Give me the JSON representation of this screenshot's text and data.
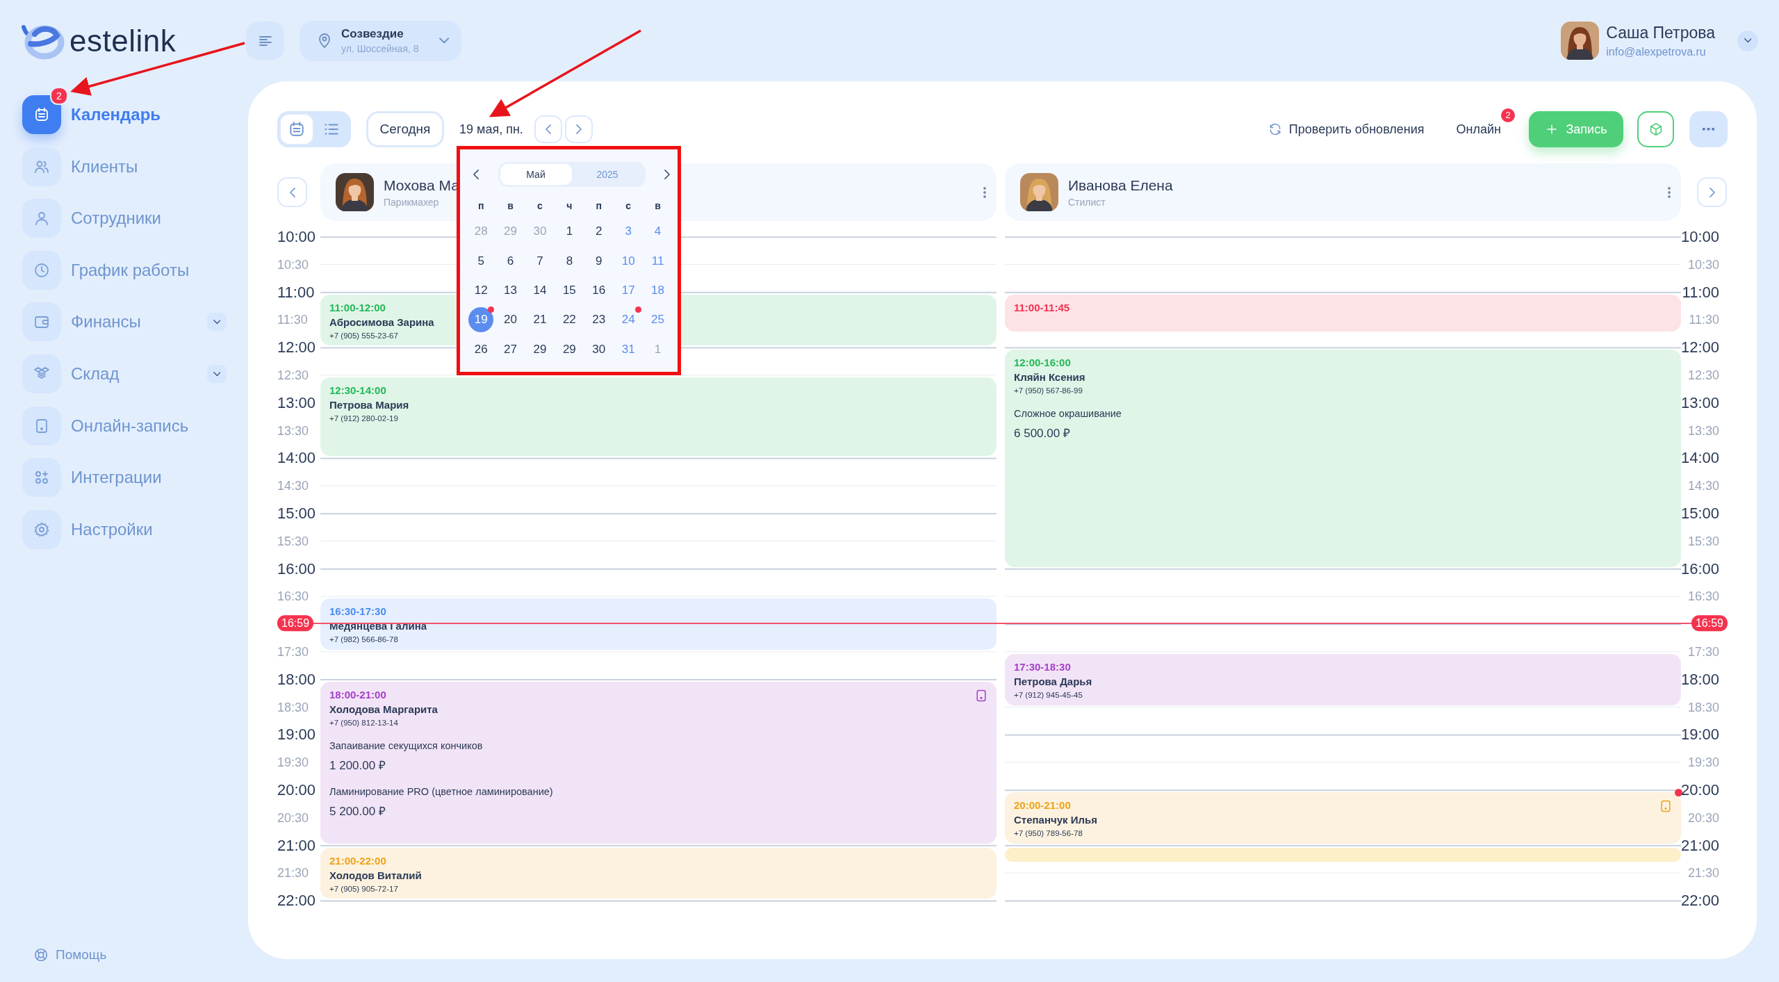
{
  "brand": {
    "name": "estelink"
  },
  "header": {
    "location": {
      "name": "Созвездие",
      "address": "ул. Шоссейная, 8"
    },
    "user": {
      "name": "Саша Петрова",
      "email": "info@alexpetrova.ru"
    }
  },
  "sidebar": {
    "items": [
      {
        "label": "Календарь",
        "selected": true,
        "badge": "2",
        "expandable": false
      },
      {
        "label": "Клиенты",
        "selected": false,
        "expandable": false
      },
      {
        "label": "Сотрудники",
        "selected": false,
        "expandable": false
      },
      {
        "label": "График работы",
        "selected": false,
        "expandable": false
      },
      {
        "label": "Финансы",
        "selected": false,
        "expandable": true
      },
      {
        "label": "Склад",
        "selected": false,
        "expandable": true
      },
      {
        "label": "Онлайн-запись",
        "selected": false,
        "expandable": false
      },
      {
        "label": "Интеграции",
        "selected": false,
        "expandable": false
      },
      {
        "label": "Настройки",
        "selected": false,
        "expandable": false
      }
    ],
    "help": "Помощь"
  },
  "toolbar": {
    "views": [
      {
        "kind": "calendar",
        "selected": true
      },
      {
        "kind": "list",
        "selected": false
      }
    ],
    "today": "Сегодня",
    "date": "19 мая, пн.",
    "check_updates": "Проверить обновления",
    "online": {
      "label": "Онлайн",
      "badge": "2"
    },
    "new_booking": "Запись"
  },
  "staff": [
    {
      "name": "Мохова Ма",
      "role": "Парикмахер"
    },
    {
      "name": "Иванова Елена",
      "role": "Стилист"
    }
  ],
  "timeline": {
    "left_labels": [
      "10:00",
      "10:30",
      "11:00",
      "11:30",
      "12:00",
      "12:30",
      "13:00",
      "13:30",
      "14:00",
      "14:30",
      "15:00",
      "15:30",
      "16:00",
      "16:30",
      "17:30",
      "18:00",
      "18:30",
      "19:00",
      "19:30",
      "20:00",
      "20:30",
      "21:00",
      "21:30",
      "22:00"
    ],
    "right_labels": [
      "10:00",
      "10:30",
      "11:00",
      "11:30",
      "12:00",
      "12:30",
      "13:00",
      "13:30",
      "14:00",
      "14:30",
      "15:00",
      "15:30",
      "16:00",
      "16:30",
      "17:30",
      "18:00",
      "18:30",
      "19:00",
      "19:30",
      "20:00",
      "20:30",
      "21:00",
      "21:30",
      "22:00"
    ],
    "now_left": "16:59",
    "now_right": "16:59",
    "columns": [
      {
        "events": [
          {
            "kind": "booking",
            "time": "11:00-12:00",
            "client": "Абросимова Зарина",
            "phone": "+7 (905) 555-23-67",
            "color": "#22b857",
            "online": false,
            "alert": false
          },
          {
            "kind": "booking",
            "time": "12:30-14:00",
            "client": "Петрова Мария",
            "phone": "+7 (912) 280-02-19",
            "color": "#22b857",
            "online": false,
            "alert": false
          },
          {
            "kind": "booking",
            "time": "16:30-17:30",
            "client": "Медянцева Галина",
            "phone": "+7 (982) 566-86-78",
            "color": "#4a8cf0",
            "online": false,
            "alert": false
          },
          {
            "kind": "booking",
            "time": "18:00-21:00",
            "client": "Холодова Маргарита",
            "phone": "+7 (950) 812-13-14",
            "color": "#a43fc8",
            "online": true,
            "alert": false,
            "services": [
              {
                "name": "Запаивание секущихся кончиков",
                "price": "1 200.00 ₽"
              },
              {
                "name": "Ламинирование PRO (цветное ламинирование)",
                "price": "5 200.00 ₽"
              }
            ]
          },
          {
            "kind": "booking",
            "time": "21:00-22:00",
            "client": "Холодов Виталий",
            "phone": "+7 (905) 905-72-17",
            "color": "#eda21a",
            "online": false,
            "alert": false
          }
        ]
      },
      {
        "events": [
          {
            "kind": "booking",
            "time": "11:00-11:45",
            "color": "#f2334f",
            "online": false,
            "alert": false
          },
          {
            "kind": "booking",
            "time": "12:00-16:00",
            "client": "Кляйн Ксения",
            "phone": "+7 (950) 567-86-99",
            "color": "#22b857",
            "online": false,
            "alert": false,
            "services": [
              {
                "name": "Сложное окрашивание",
                "price": "6 500.00 ₽"
              }
            ]
          },
          {
            "kind": "booking",
            "time": "17:30-18:30",
            "client": "Петрова Дарья",
            "phone": "+7 (912) 945-45-45",
            "color": "#a43fc8",
            "online": false,
            "alert": false
          },
          {
            "kind": "booking",
            "time": "20:00-21:00",
            "client": "Степанчук Илья",
            "phone": "+7 (950) 789-56-78",
            "color": "#eda21a",
            "online": true,
            "alert": true
          },
          {
            "kind": "break",
            "color": "#fdefc8"
          }
        ]
      }
    ]
  },
  "date_picker": {
    "tabs": [
      {
        "label": "Май",
        "selected": true
      },
      {
        "label": "2025",
        "selected": false
      }
    ],
    "weekdays": [
      "п",
      "в",
      "с",
      "ч",
      "п",
      "с",
      "в"
    ],
    "days": [
      {
        "label": "28",
        "kind": "other",
        "selected": false,
        "event": false
      },
      {
        "label": "29",
        "kind": "other",
        "selected": false,
        "event": false
      },
      {
        "label": "30",
        "kind": "other",
        "selected": false,
        "event": false
      },
      {
        "label": "1",
        "kind": "day",
        "selected": false,
        "event": false
      },
      {
        "label": "2",
        "kind": "day",
        "selected": false,
        "event": false
      },
      {
        "label": "3",
        "kind": "weekend",
        "selected": false,
        "event": false
      },
      {
        "label": "4",
        "kind": "weekend",
        "selected": false,
        "event": false
      },
      {
        "label": "5",
        "kind": "day",
        "selected": false,
        "event": false
      },
      {
        "label": "6",
        "kind": "day",
        "selected": false,
        "event": false
      },
      {
        "label": "7",
        "kind": "day",
        "selected": false,
        "event": false
      },
      {
        "label": "8",
        "kind": "day",
        "selected": false,
        "event": false
      },
      {
        "label": "9",
        "kind": "day",
        "selected": false,
        "event": false
      },
      {
        "label": "10",
        "kind": "weekend",
        "selected": false,
        "event": false
      },
      {
        "label": "11",
        "kind": "weekend",
        "selected": false,
        "event": false
      },
      {
        "label": "12",
        "kind": "day",
        "selected": false,
        "event": false
      },
      {
        "label": "13",
        "kind": "day",
        "selected": false,
        "event": false
      },
      {
        "label": "14",
        "kind": "day",
        "selected": false,
        "event": false
      },
      {
        "label": "15",
        "kind": "day",
        "selected": false,
        "event": false
      },
      {
        "label": "16",
        "kind": "day",
        "selected": false,
        "event": false
      },
      {
        "label": "17",
        "kind": "weekend",
        "selected": false,
        "event": false
      },
      {
        "label": "18",
        "kind": "weekend",
        "selected": false,
        "event": false
      },
      {
        "label": "19",
        "kind": "day",
        "selected": true,
        "event": true
      },
      {
        "label": "20",
        "kind": "day",
        "selected": false,
        "event": false
      },
      {
        "label": "21",
        "kind": "day",
        "selected": false,
        "event": false
      },
      {
        "label": "22",
        "kind": "day",
        "selected": false,
        "event": false
      },
      {
        "label": "23",
        "kind": "day",
        "selected": false,
        "event": false
      },
      {
        "label": "24",
        "kind": "weekend",
        "selected": false,
        "event": true
      },
      {
        "label": "25",
        "kind": "weekend",
        "selected": false,
        "event": false
      },
      {
        "label": "26",
        "kind": "day",
        "selected": false,
        "event": false
      },
      {
        "label": "27",
        "kind": "day",
        "selected": false,
        "event": false
      },
      {
        "label": "29",
        "kind": "day",
        "selected": false,
        "event": false
      },
      {
        "label": "29",
        "kind": "day",
        "selected": false,
        "event": false
      },
      {
        "label": "30",
        "kind": "day",
        "selected": false,
        "event": false
      },
      {
        "label": "31",
        "kind": "weekend",
        "selected": false,
        "event": false
      },
      {
        "label": "1",
        "kind": "other",
        "selected": false,
        "event": false
      }
    ]
  }
}
